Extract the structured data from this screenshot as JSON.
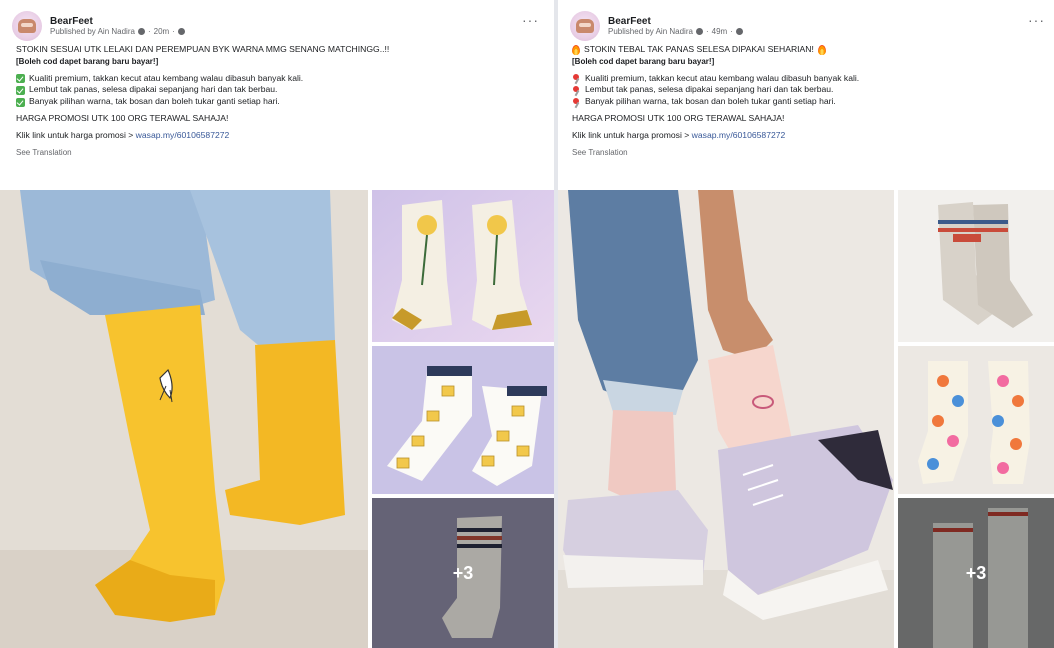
{
  "posts": [
    {
      "page_name": "BearFeet",
      "published_by": "Published by Ain Nadira",
      "time": "20m",
      "more_label": "···",
      "headline": "STOKIN SESUAI UTK LELAKI DAN PEREMPUAN BYK WARNA MMG SENANG MATCHINGG..!!",
      "subline": "[Boleh cod dapet barang baru bayar!]",
      "bullets": [
        "Kualiti premium, takkan kecut atau kembang walau dibasuh banyak kali.",
        "Lembut tak panas, selesa dipakai sepanjang hari dan tak berbau.",
        "Banyak pilihan warna, tak bosan dan boleh tukar ganti setiap hari."
      ],
      "promo": "HARGA PROMOSI UTK 100 ORG TERAWAL SAHAJA!",
      "link_prefix": "Klik link untuk harga promosi > ",
      "link_text": "wasap.my/60106587272",
      "see_translation": "See Translation",
      "more_photos": "+3",
      "photos": [
        {
          "name": "yellow-sock-banana-photo",
          "desc_icon": "photo"
        },
        {
          "name": "flower-socks-photo",
          "desc_icon": "photo"
        },
        {
          "name": "cheese-socks-photo",
          "desc_icon": "photo"
        },
        {
          "name": "striped-socks-photo",
          "desc_icon": "photo"
        }
      ]
    },
    {
      "page_name": "BearFeet",
      "published_by": "Published by Ain Nadira",
      "time": "49m",
      "more_label": "···",
      "headline": "STOKIN TEBAL TAK PANAS SELESA DIPAKAI SEHARIAN!",
      "subline": "[Boleh cod dapet barang baru bayar!]",
      "bullets": [
        "Kualiti premium, takkan kecut atau kembang walau dibasuh banyak kali.",
        "Lembut tak panas, selesa dipakai sepanjang hari dan tak berbau.",
        "Banyak pilihan warna, tak bosan dan boleh tukar ganti setiap hari."
      ],
      "promo": "HARGA PROMOSI UTK 100 ORG TERAWAL SAHAJA!",
      "link_prefix": "Klik link untuk harga promosi > ",
      "link_text": "wasap.my/60106587272",
      "see_translation": "See Translation",
      "more_photos": "+3",
      "photos": [
        {
          "name": "pink-sock-sneaker-photo",
          "desc_icon": "photo"
        },
        {
          "name": "dream-socks-photo",
          "desc_icon": "photo"
        },
        {
          "name": "floral-socks-photo",
          "desc_icon": "photo"
        },
        {
          "name": "ninety-one-socks-photo",
          "desc_icon": "photo"
        }
      ]
    }
  ],
  "colors": {
    "link": "#385898",
    "meta": "#65676b",
    "check": "#4caf50",
    "pin": "#e53935"
  }
}
